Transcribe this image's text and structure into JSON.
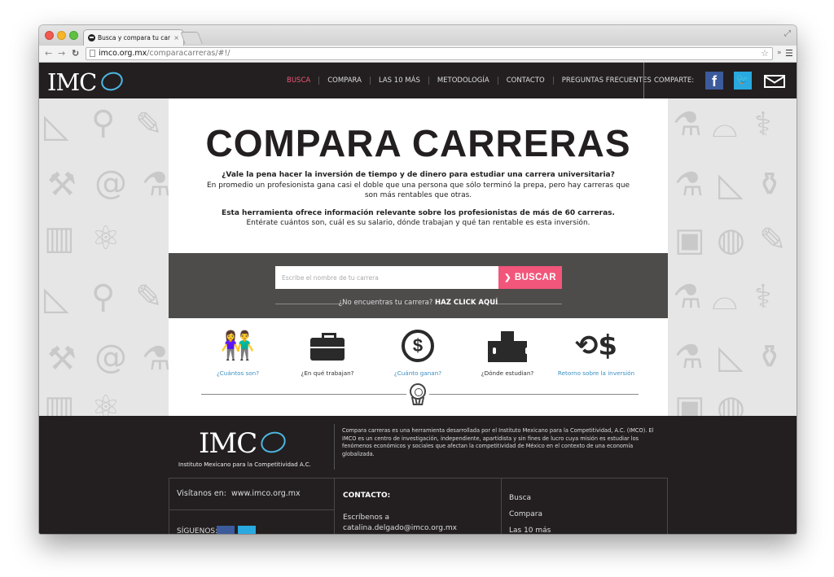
{
  "browser": {
    "tab_title": "Busca y compara tu carrera",
    "tab_close": "×",
    "url_domain": "imco.org.mx",
    "url_path": "/comparacarreras/#!/"
  },
  "header": {
    "logo_text": "IMC",
    "nav": [
      {
        "label": "BUSCA",
        "active": true
      },
      {
        "label": "COMPARA",
        "active": false
      },
      {
        "label": "LAS 10 MÁS",
        "active": false
      },
      {
        "label": "METODOLOGÍA",
        "active": false
      },
      {
        "label": "CONTACTO",
        "active": false
      },
      {
        "label": "PREGUNTAS FRECUENTES",
        "active": false
      }
    ],
    "share_label": "COMPARTE:",
    "share_fb": "f",
    "share_tw": "t"
  },
  "main": {
    "title": "COMPARA CARRERAS",
    "intro_q": "¿Vale la pena hacer la inversión de tiempo y de dinero para estudiar una carrera universitaria?",
    "intro_text": "En promedio un profesionista gana casi el doble que una persona que sólo terminó la prepa, pero hay carreras que son más rentables que otras.",
    "tool_bold": "Esta herramienta ofrece información relevante sobre los profesionistas de más de 60 carreras.",
    "tool_text": "Entérate cuántos son, cuál es su salario, dónde trabajan y qué tan rentable es esta inversión."
  },
  "search": {
    "placeholder": "Escribe el nombre de tu carrera",
    "button_label": "BUSCAR",
    "not_found": "¿No encuentras tu carrera?",
    "click_here": "HAZ CLICK AQUÍ"
  },
  "features": [
    {
      "label": "¿Cuántos son?",
      "icon": "people-icon"
    },
    {
      "label": "¿En qué trabajan?",
      "icon": "briefcase-icon"
    },
    {
      "label": "¿Cuánto ganan?",
      "icon": "dollar-icon"
    },
    {
      "label": "¿Dónde estudian?",
      "icon": "school-icon"
    },
    {
      "label": "Retorno sobre la inversión",
      "icon": "return-dollar-icon"
    }
  ],
  "footer": {
    "logo_text": "IMC",
    "subtitle": "Instituto Mexicano para la Competitividad A.C.",
    "about": "Compara carreras es una herramienta desarrollada por el Instituto Mexicano para la Competitividad, A.C. (IMCO). El IMCO es un centro de investigación, independiente, apartidista y sin fines de lucro cuya misión es estudiar los fenómenos económicos y sociales que afectan la competitividad de México en el contexto de una economía globalizada.",
    "visit_label": "Visítanos en:",
    "visit_url": "www.imco.org.mx",
    "follow_label": "SÍGUENOS:",
    "contact_title": "CONTACTO:",
    "contact_line1": "Escríbenos a",
    "contact_email": "catalina.delgado@imco.org.mx",
    "links": [
      "Busca",
      "Compara",
      "Las 10 más"
    ]
  },
  "colors": {
    "accent": "#f2567a",
    "header_bg": "#231f20",
    "search_band": "#4e4b4b",
    "link": "#3b8fc2"
  }
}
